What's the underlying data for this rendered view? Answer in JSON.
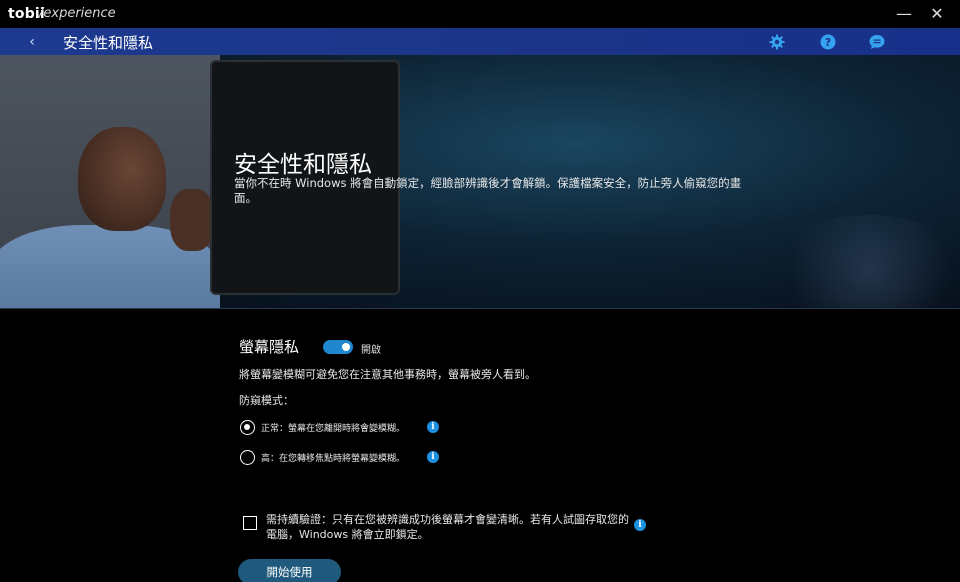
{
  "app": {
    "logo": "tobii",
    "logo_sub": "/experience",
    "minimize_glyph": "—",
    "close_glyph": "✕"
  },
  "nav": {
    "back_glyph": "‹",
    "title": "安全性和隱私",
    "icons": [
      "gear-icon",
      "help-icon",
      "chat-icon"
    ]
  },
  "hero": {
    "title": "安全性和隱私",
    "description": "當你不在時 Windows 將會自動鎖定，經臉部辨識後才會解鎖。保護檔案安全，防止旁人偷窺您的畫面。"
  },
  "privacy": {
    "title": "螢幕隱私",
    "toggle_on": true,
    "toggle_label": "開啟",
    "description": "將螢幕變模糊可避免您在注意其他事務時，螢幕被旁人看到。",
    "mode_label": "防窺模式：",
    "options": [
      {
        "label": "正常：螢幕在您離開時將會變模糊。",
        "selected": true
      },
      {
        "label": "高：在您轉移焦點時將螢幕變模糊。",
        "selected": false
      }
    ],
    "info_glyph": "i"
  },
  "verify": {
    "checked": false,
    "text": "需持續驗證：只有在您被辨識成功後螢幕才會變清晰。若有人試圖存取您的電腦，Windows 將會立即鎖定。"
  },
  "start_button": "開始使用",
  "colors": {
    "accent": "#1e87d0",
    "navbar": "#1b3487",
    "button": "#1f5a7c",
    "info": "#1e90e0"
  }
}
